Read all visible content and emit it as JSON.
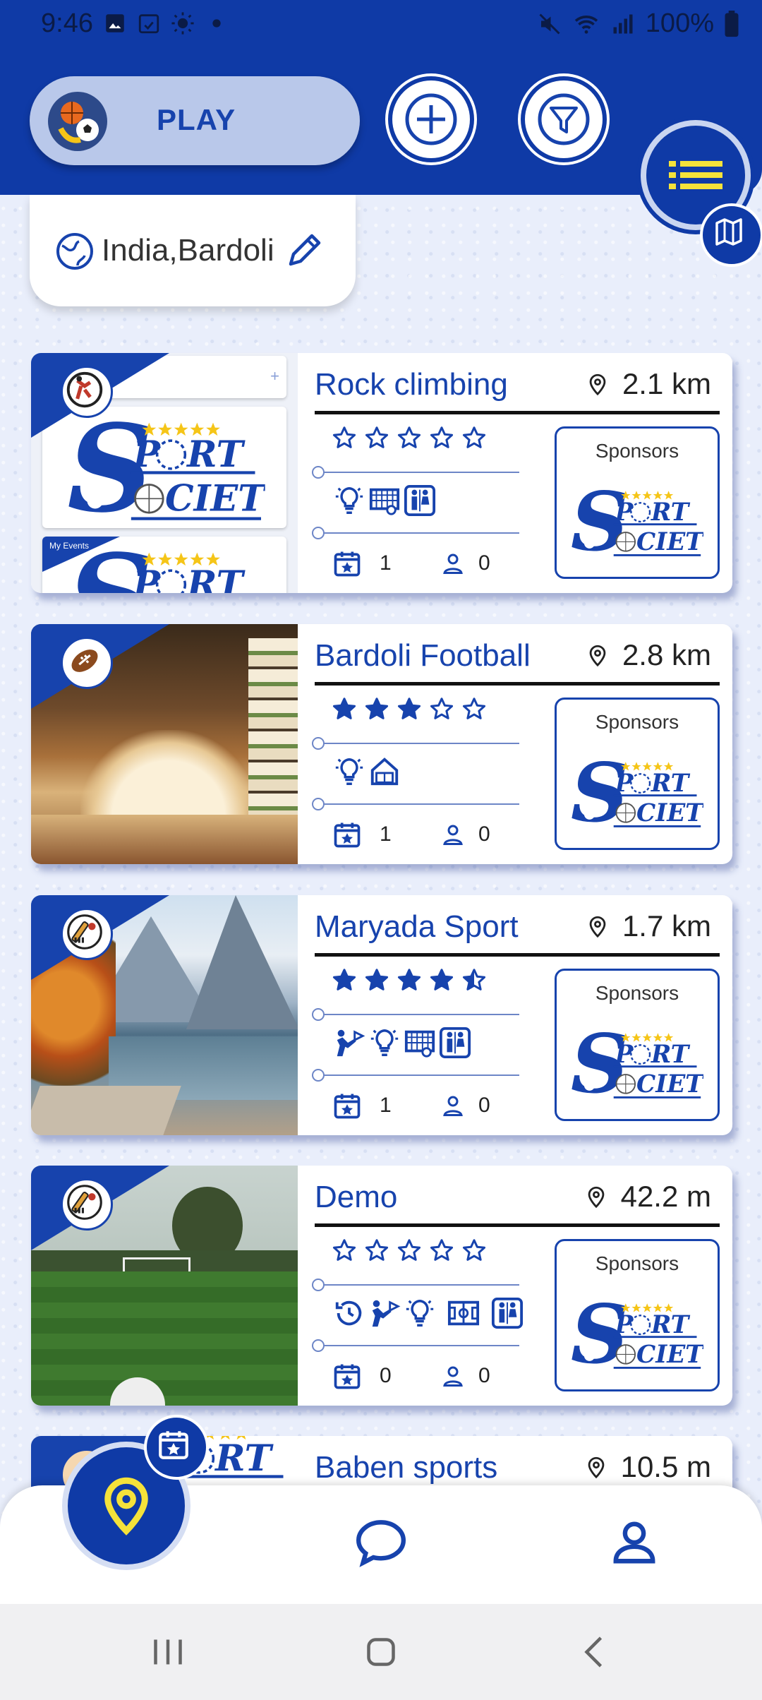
{
  "status_bar": {
    "time": "9:46",
    "battery": "100%"
  },
  "header": {
    "play_label": "PLAY"
  },
  "location": {
    "text": "India,Bardoli"
  },
  "venues": [
    {
      "title": "Rock climbing",
      "distance": "2.1 km",
      "rating": 0,
      "events": "1",
      "members": "0",
      "sponsors_label": "Sponsors"
    },
    {
      "title": "Bardoli Football",
      "distance": "2.8 km",
      "rating": 3,
      "events": "1",
      "members": "0",
      "sponsors_label": "Sponsors"
    },
    {
      "title": "Maryada Sport",
      "distance": "1.7 km",
      "rating": 4.5,
      "events": "1",
      "members": "0",
      "sponsors_label": "Sponsors"
    },
    {
      "title": "Demo",
      "distance": "42.2 m",
      "rating": 0,
      "events": "0",
      "members": "0",
      "sponsors_label": "Sponsors"
    },
    {
      "title": "Baben sports",
      "distance": "10.5 m"
    }
  ],
  "logo_text": {
    "line1": "PORT",
    "line2": "CIETY",
    "tag": "My Events"
  }
}
